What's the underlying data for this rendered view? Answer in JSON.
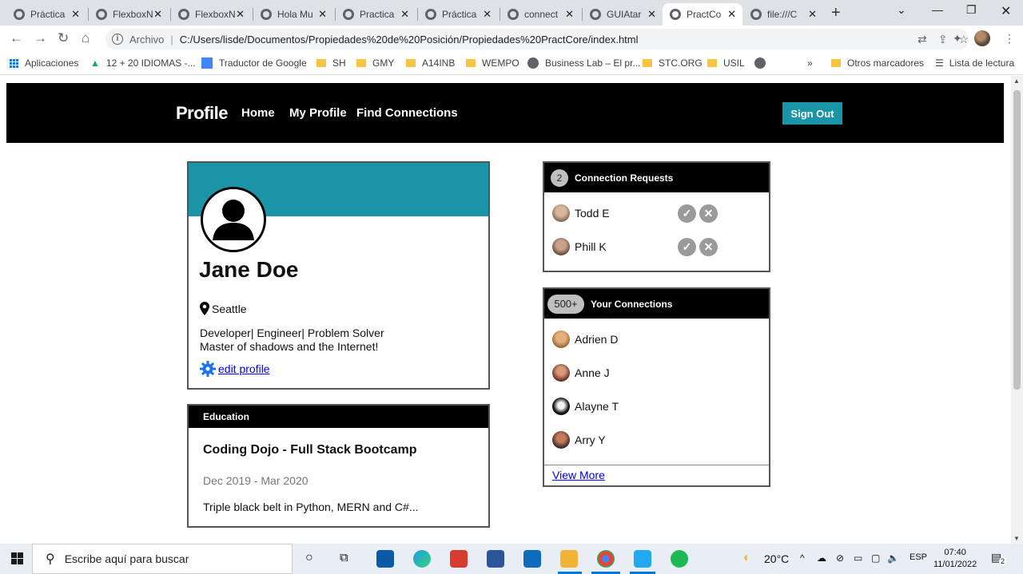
{
  "browser": {
    "tabs": [
      {
        "title": "Práctica"
      },
      {
        "title": "FlexboxN"
      },
      {
        "title": "FlexboxN"
      },
      {
        "title": "Hola Mu"
      },
      {
        "title": "Practica"
      },
      {
        "title": "Práctica"
      },
      {
        "title": "connect"
      },
      {
        "title": "GUIAtar"
      },
      {
        "title": "PractCo"
      },
      {
        "title": "file:///C"
      }
    ],
    "active_tab": 8,
    "protocol_label": "Archivo",
    "url": "C:/Users/lisde/Documentos/Propiedades%20de%20Posición/Propiedades%20PractCore/index.html",
    "bookmarks": [
      "Aplicaciones",
      "12 + 20 IDIOMAS -...",
      "Traductor de Google",
      "SH",
      "GMY",
      "A14INB",
      "WEMPO",
      "Business Lab – El pr...",
      "STC.ORG",
      "USIL"
    ],
    "bookmarks_overflow": "»",
    "other_bookmarks": "Otros marcadores",
    "reading_list": "Lista de lectura"
  },
  "site": {
    "brand": "Profile",
    "nav": [
      "Home",
      "My Profile",
      "Find Connections"
    ],
    "sign_out": "Sign Out",
    "accent": "#1a94a6"
  },
  "profile": {
    "name": "Jane Doe",
    "location": "Seattle",
    "bio_line1": "Developer| Engineer| Problem Solver",
    "bio_line2": "Master of shadows and the Internet!",
    "edit_label": "edit profile"
  },
  "education": {
    "heading": "Education",
    "school": "Coding Dojo - Full Stack Bootcamp",
    "dates": "Dec 2019 - Mar 2020",
    "description": "Triple black belt in Python, MERN and C#..."
  },
  "requests": {
    "count": "2",
    "heading": "Connection Requests",
    "items": [
      {
        "name": "Todd E"
      },
      {
        "name": "Phill K"
      }
    ]
  },
  "connections": {
    "count": "500+",
    "heading": "Your Connections",
    "items": [
      {
        "name": "Adrien D"
      },
      {
        "name": "Anne J"
      },
      {
        "name": "Alayne T"
      },
      {
        "name": "Arry Y"
      }
    ],
    "view_more": "View More"
  },
  "taskbar": {
    "search_placeholder": "Escribe aquí para buscar",
    "weather": "20°C",
    "lang": "ESP",
    "time": "07:40",
    "date": "11/01/2022",
    "notifications": "2"
  }
}
